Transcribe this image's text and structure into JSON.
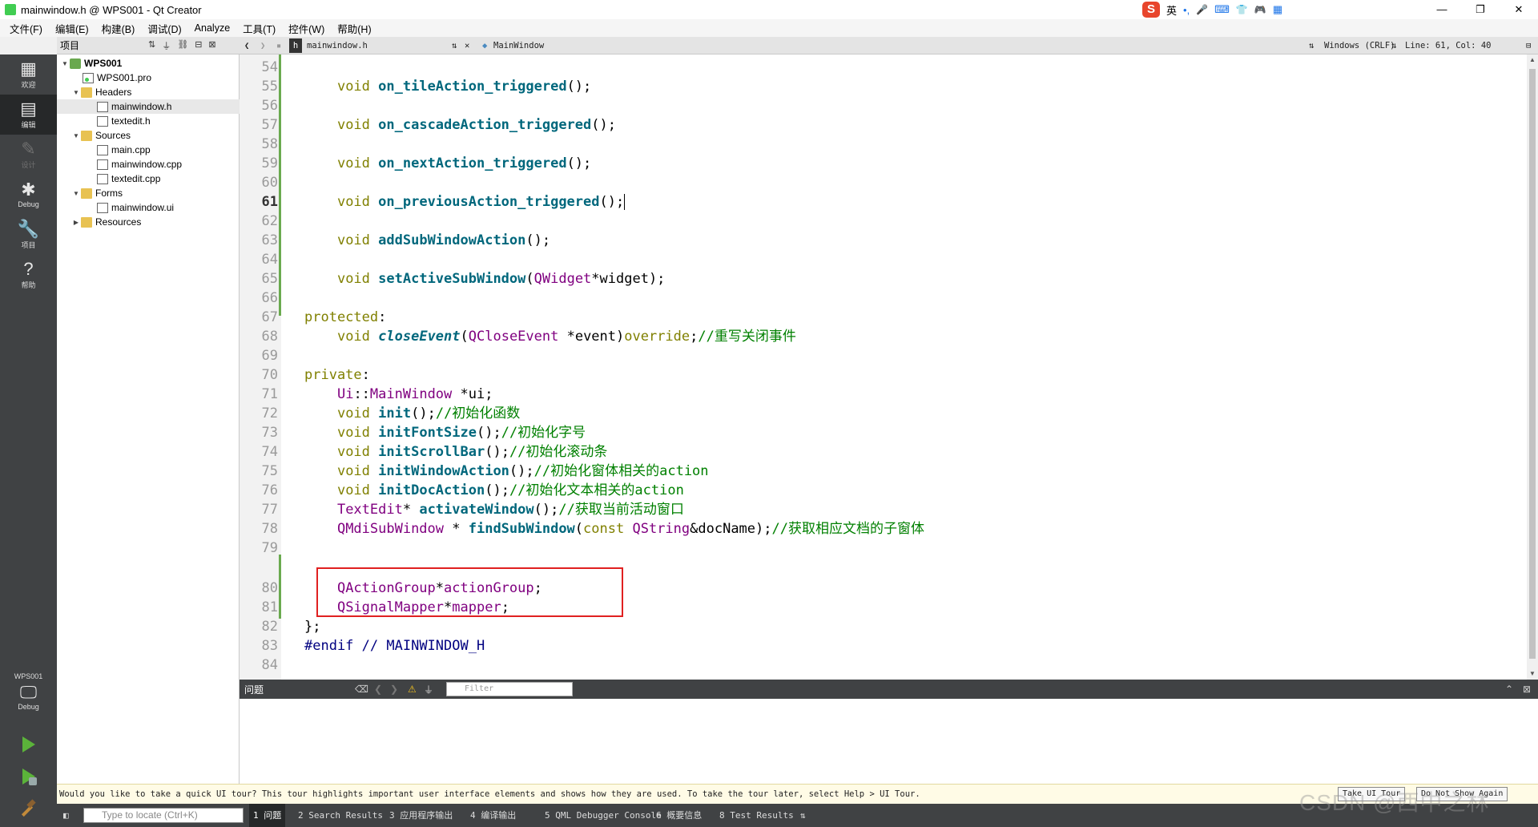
{
  "window": {
    "title": "mainwindow.h @ WPS001 - Qt Creator",
    "minimize": "—",
    "maximize": "❐",
    "close": "✕"
  },
  "ime": {
    "logo": "S",
    "lang": "英",
    "punct": "•,",
    "mic": "🎤",
    "keyboard": "⌨",
    "skin": "👕",
    "game": "🎮",
    "grid": "▦"
  },
  "menu": [
    "文件(F)",
    "编辑(E)",
    "构建(B)",
    "调试(D)",
    "Analyze",
    "工具(T)",
    "控件(W)",
    "帮助(H)"
  ],
  "modes": [
    {
      "label": "欢迎",
      "icon": "grid-icon"
    },
    {
      "label": "编辑",
      "icon": "edit-icon"
    },
    {
      "label": "设计",
      "icon": "pen-icon"
    },
    {
      "label": "Debug",
      "icon": "bug-icon"
    },
    {
      "label": "项目",
      "icon": "wrench-icon"
    },
    {
      "label": "帮助",
      "icon": "help-icon"
    }
  ],
  "kit": {
    "project": "WPS001",
    "mode": "Debug"
  },
  "project_panel": {
    "title": "项目",
    "tree": [
      {
        "label": "WPS001",
        "level": 0,
        "type": "project",
        "expanded": true
      },
      {
        "label": "WPS001.pro",
        "level": 1,
        "type": "pro"
      },
      {
        "label": "Headers",
        "level": 1,
        "type": "folder",
        "expanded": true
      },
      {
        "label": "mainwindow.h",
        "level": 2,
        "type": "file",
        "selected": true
      },
      {
        "label": "textedit.h",
        "level": 2,
        "type": "file"
      },
      {
        "label": "Sources",
        "level": 1,
        "type": "folder",
        "expanded": true
      },
      {
        "label": "main.cpp",
        "level": 2,
        "type": "file"
      },
      {
        "label": "mainwindow.cpp",
        "level": 2,
        "type": "file"
      },
      {
        "label": "textedit.cpp",
        "level": 2,
        "type": "file"
      },
      {
        "label": "Forms",
        "level": 1,
        "type": "folder",
        "expanded": true
      },
      {
        "label": "mainwindow.ui",
        "level": 2,
        "type": "file"
      },
      {
        "label": "Resources",
        "level": 1,
        "type": "folder",
        "expanded": false
      }
    ]
  },
  "editor_toolbar": {
    "file_name": "mainwindow.h",
    "symbol": "MainWindow",
    "line_ending": "Windows (CRLF)",
    "position": "Line: 61, Col: 40"
  },
  "code": {
    "current_line": 61,
    "lines": [
      {
        "n": 54,
        "tokens": []
      },
      {
        "n": 55,
        "tokens": [
          [
            "",
            "    "
          ],
          [
            "kw",
            "void"
          ],
          [
            "",
            " "
          ],
          [
            "fn",
            "on_tileAction_triggered"
          ],
          [
            "",
            "();"
          ]
        ]
      },
      {
        "n": 56,
        "tokens": []
      },
      {
        "n": 57,
        "tokens": [
          [
            "",
            "    "
          ],
          [
            "kw",
            "void"
          ],
          [
            "",
            " "
          ],
          [
            "fn",
            "on_cascadeAction_triggered"
          ],
          [
            "",
            "();"
          ]
        ]
      },
      {
        "n": 58,
        "tokens": []
      },
      {
        "n": 59,
        "tokens": [
          [
            "",
            "    "
          ],
          [
            "kw",
            "void"
          ],
          [
            "",
            " "
          ],
          [
            "fn",
            "on_nextAction_triggered"
          ],
          [
            "",
            "();"
          ]
        ]
      },
      {
        "n": 60,
        "tokens": []
      },
      {
        "n": 61,
        "tokens": [
          [
            "",
            "    "
          ],
          [
            "kw",
            "void"
          ],
          [
            "",
            " "
          ],
          [
            "fn",
            "on_previousAction_triggered"
          ],
          [
            "",
            "();"
          ]
        ],
        "cursor": true
      },
      {
        "n": 62,
        "tokens": []
      },
      {
        "n": 63,
        "tokens": [
          [
            "",
            "    "
          ],
          [
            "kw",
            "void"
          ],
          [
            "",
            " "
          ],
          [
            "fn",
            "addSubWindowAction"
          ],
          [
            "",
            "();"
          ]
        ]
      },
      {
        "n": 64,
        "tokens": []
      },
      {
        "n": 65,
        "tokens": [
          [
            "",
            "    "
          ],
          [
            "kw",
            "void"
          ],
          [
            "",
            " "
          ],
          [
            "fn",
            "setActiveSubWindow"
          ],
          [
            "",
            "("
          ],
          [
            "ty",
            "QWidget"
          ],
          [
            "",
            "*widget);"
          ]
        ]
      },
      {
        "n": 66,
        "tokens": []
      },
      {
        "n": 67,
        "tokens": [
          [
            "kw",
            "protected"
          ],
          [
            "",
            ":"
          ]
        ]
      },
      {
        "n": 68,
        "tokens": [
          [
            "",
            "    "
          ],
          [
            "kw",
            "void"
          ],
          [
            "",
            " "
          ],
          [
            "fn-i",
            "closeEvent"
          ],
          [
            "",
            "("
          ],
          [
            "ty",
            "QCloseEvent"
          ],
          [
            "",
            " *event)"
          ],
          [
            "kw",
            "override"
          ],
          [
            "",
            ";"
          ],
          [
            "cm",
            "//重写关闭事件"
          ]
        ]
      },
      {
        "n": 69,
        "tokens": []
      },
      {
        "n": 70,
        "tokens": [
          [
            "kw",
            "private"
          ],
          [
            "",
            ":"
          ]
        ]
      },
      {
        "n": 71,
        "tokens": [
          [
            "",
            "    "
          ],
          [
            "ty",
            "Ui"
          ],
          [
            "",
            "::"
          ],
          [
            "ty",
            "MainWindow"
          ],
          [
            "",
            " *ui;"
          ]
        ]
      },
      {
        "n": 72,
        "tokens": [
          [
            "",
            "    "
          ],
          [
            "kw",
            "void"
          ],
          [
            "",
            " "
          ],
          [
            "fn",
            "init"
          ],
          [
            "",
            "();"
          ],
          [
            "cm",
            "//初始化函数"
          ]
        ]
      },
      {
        "n": 73,
        "tokens": [
          [
            "",
            "    "
          ],
          [
            "kw",
            "void"
          ],
          [
            "",
            " "
          ],
          [
            "fn",
            "initFontSize"
          ],
          [
            "",
            "();"
          ],
          [
            "cm",
            "//初始化字号"
          ]
        ]
      },
      {
        "n": 74,
        "tokens": [
          [
            "",
            "    "
          ],
          [
            "kw",
            "void"
          ],
          [
            "",
            " "
          ],
          [
            "fn",
            "initScrollBar"
          ],
          [
            "",
            "();"
          ],
          [
            "cm",
            "//初始化滚动条"
          ]
        ]
      },
      {
        "n": 75,
        "tokens": [
          [
            "",
            "    "
          ],
          [
            "kw",
            "void"
          ],
          [
            "",
            " "
          ],
          [
            "fn",
            "initWindowAction"
          ],
          [
            "",
            "();"
          ],
          [
            "cm",
            "//初始化窗体相关的action"
          ]
        ]
      },
      {
        "n": 76,
        "tokens": [
          [
            "",
            "    "
          ],
          [
            "kw",
            "void"
          ],
          [
            "",
            " "
          ],
          [
            "fn",
            "initDocAction"
          ],
          [
            "",
            "();"
          ],
          [
            "cm",
            "//初始化文本相关的action"
          ]
        ]
      },
      {
        "n": 77,
        "tokens": [
          [
            "",
            "    "
          ],
          [
            "ty",
            "TextEdit"
          ],
          [
            "",
            "* "
          ],
          [
            "fn",
            "activateWindow"
          ],
          [
            "",
            "();"
          ],
          [
            "cm",
            "//获取当前活动窗口"
          ]
        ]
      },
      {
        "n": 78,
        "tokens": [
          [
            "",
            "    "
          ],
          [
            "ty",
            "QMdiSubWindow"
          ],
          [
            "",
            " * "
          ],
          [
            "fn",
            "findSubWindow"
          ],
          [
            "",
            "("
          ],
          [
            "kw",
            "const"
          ],
          [
            "",
            " "
          ],
          [
            "ty",
            "QString"
          ],
          [
            "",
            "&docName);"
          ],
          [
            "cm",
            "//获取相应文档的子窗体"
          ]
        ]
      },
      {
        "n": 79,
        "tokens": []
      },
      {
        "n": 80,
        "tokens": [
          [
            "",
            "    "
          ],
          [
            "ty",
            "QActionGroup"
          ],
          [
            "",
            "*"
          ],
          [
            "ty",
            "actionGroup"
          ],
          [
            "",
            ";"
          ]
        ]
      },
      {
        "n": 81,
        "tokens": [
          [
            "",
            "    "
          ],
          [
            "ty",
            "QSignalMapper"
          ],
          [
            "",
            "*"
          ],
          [
            "ty",
            "mapper"
          ],
          [
            "",
            ";"
          ]
        ]
      },
      {
        "n": 82,
        "tokens": [
          [
            "",
            "};"
          ]
        ]
      },
      {
        "n": 83,
        "tokens": [
          [
            "pp",
            "#endif"
          ],
          [
            "",
            " "
          ],
          [
            "pp",
            "// MAINWINDOW_H"
          ]
        ]
      },
      {
        "n": 84,
        "tokens": []
      }
    ]
  },
  "issues": {
    "title": "问题",
    "filter_placeholder": "Filter"
  },
  "tour": {
    "message": "Would you like to take a quick UI tour? This tour highlights important user interface elements and shows how they are used. To take the tour later, select Help > UI Tour.",
    "take_button": "Take UI Tour",
    "dismiss_button": "Do Not Show Again"
  },
  "statusbar": {
    "locate_placeholder": "Type to locate (Ctrl+K)",
    "tabs": [
      "1 问题",
      "2 Search Results",
      "3 应用程序输出",
      "4 编译输出",
      "5 QML Debugger Console",
      "6 概要信息",
      "8 Test Results"
    ]
  },
  "watermark": "CSDN @西中之林"
}
